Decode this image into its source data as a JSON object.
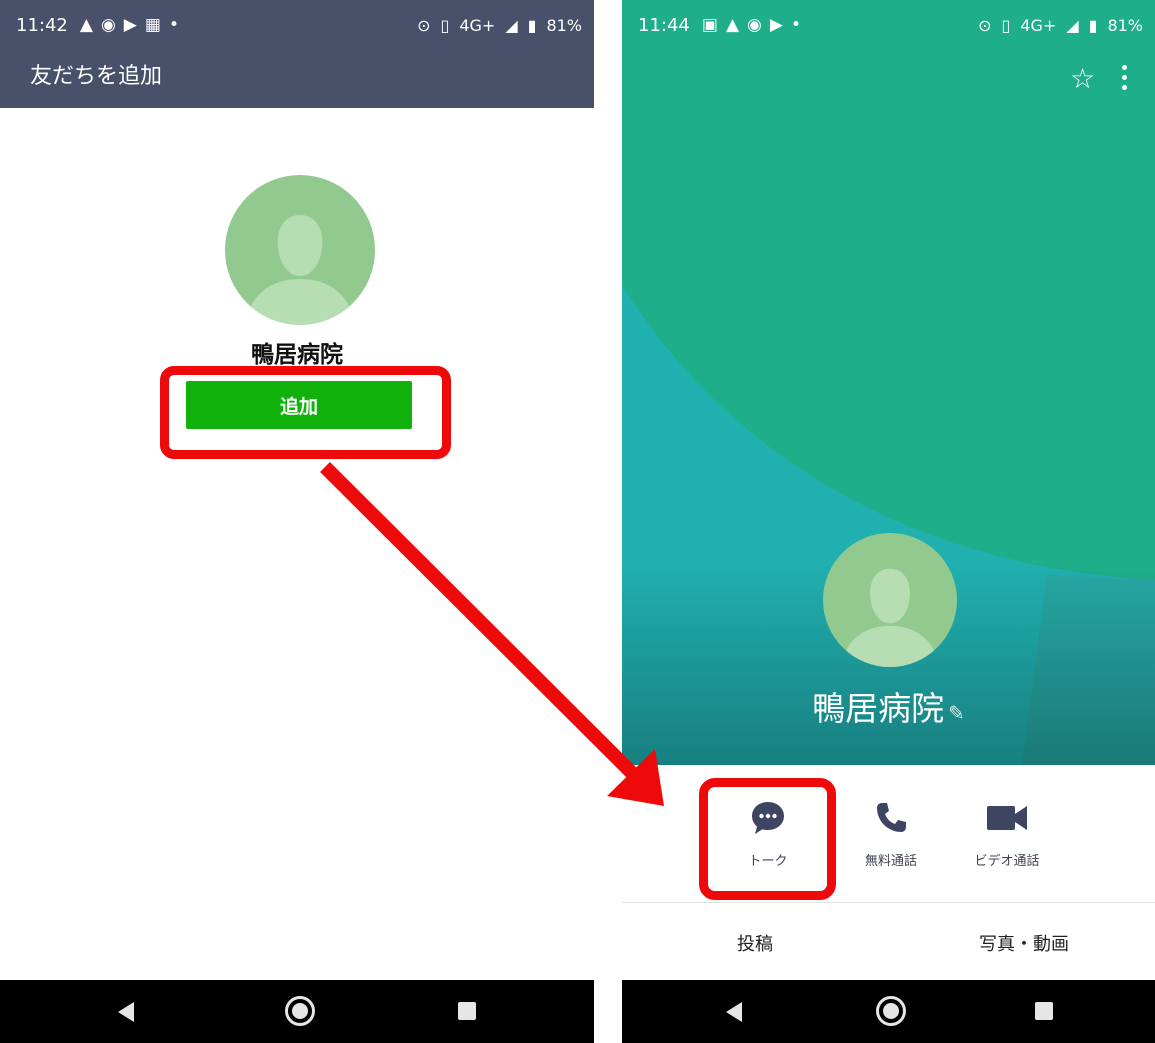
{
  "left": {
    "status": {
      "time": "11:42",
      "battery": "81%",
      "network": "4G+"
    },
    "header": {
      "title": "友だちを追加"
    },
    "contact": {
      "name": "鴨居病院"
    },
    "add_button_label": "追加"
  },
  "right": {
    "status": {
      "time": "11:44",
      "battery": "81%",
      "network": "4G+"
    },
    "profile": {
      "name": "鴨居病院"
    },
    "actions": [
      {
        "label": "トーク",
        "icon": "chat-bubble-icon"
      },
      {
        "label": "無料通話",
        "icon": "phone-icon"
      },
      {
        "label": "ビデオ通話",
        "icon": "video-camera-icon"
      }
    ],
    "tabs": [
      {
        "label": "投稿"
      },
      {
        "label": "写真・動画"
      }
    ]
  },
  "colors": {
    "header_bg": "#49506a",
    "add_button": "#10b20b",
    "highlight": "#ee0a0a",
    "hero_green": "#1fae8a",
    "hero_teal": "#21b0b0",
    "avatar": "#92c98f"
  }
}
